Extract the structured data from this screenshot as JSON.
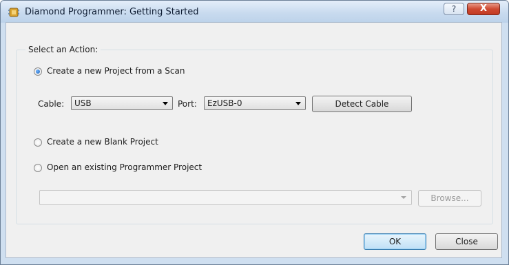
{
  "window": {
    "title": "Diamond Programmer: Getting Started",
    "help_glyph": "?",
    "close_glyph": "X"
  },
  "group": {
    "legend": "Select an Action:"
  },
  "options": {
    "scan": {
      "label": "Create a new Project from a Scan",
      "selected": true
    },
    "blank": {
      "label": "Create a new Blank Project",
      "selected": false
    },
    "open": {
      "label": "Open an existing Programmer Project",
      "selected": false
    }
  },
  "cable": {
    "label": "Cable:",
    "value": "USB"
  },
  "port": {
    "label": "Port:",
    "value": "EzUSB-0"
  },
  "detect_cable_label": "Detect Cable",
  "project_path": {
    "value": "",
    "browse_label": "Browse..."
  },
  "footer": {
    "ok_label": "OK",
    "close_label": "Close"
  },
  "colors": {
    "title_bar": "#c9dbef",
    "close_button": "#c23a22",
    "ok_focus": "#3c7fb1"
  },
  "icons": {
    "app": "diamond-app-icon",
    "help": "help-icon",
    "close": "close-icon"
  }
}
